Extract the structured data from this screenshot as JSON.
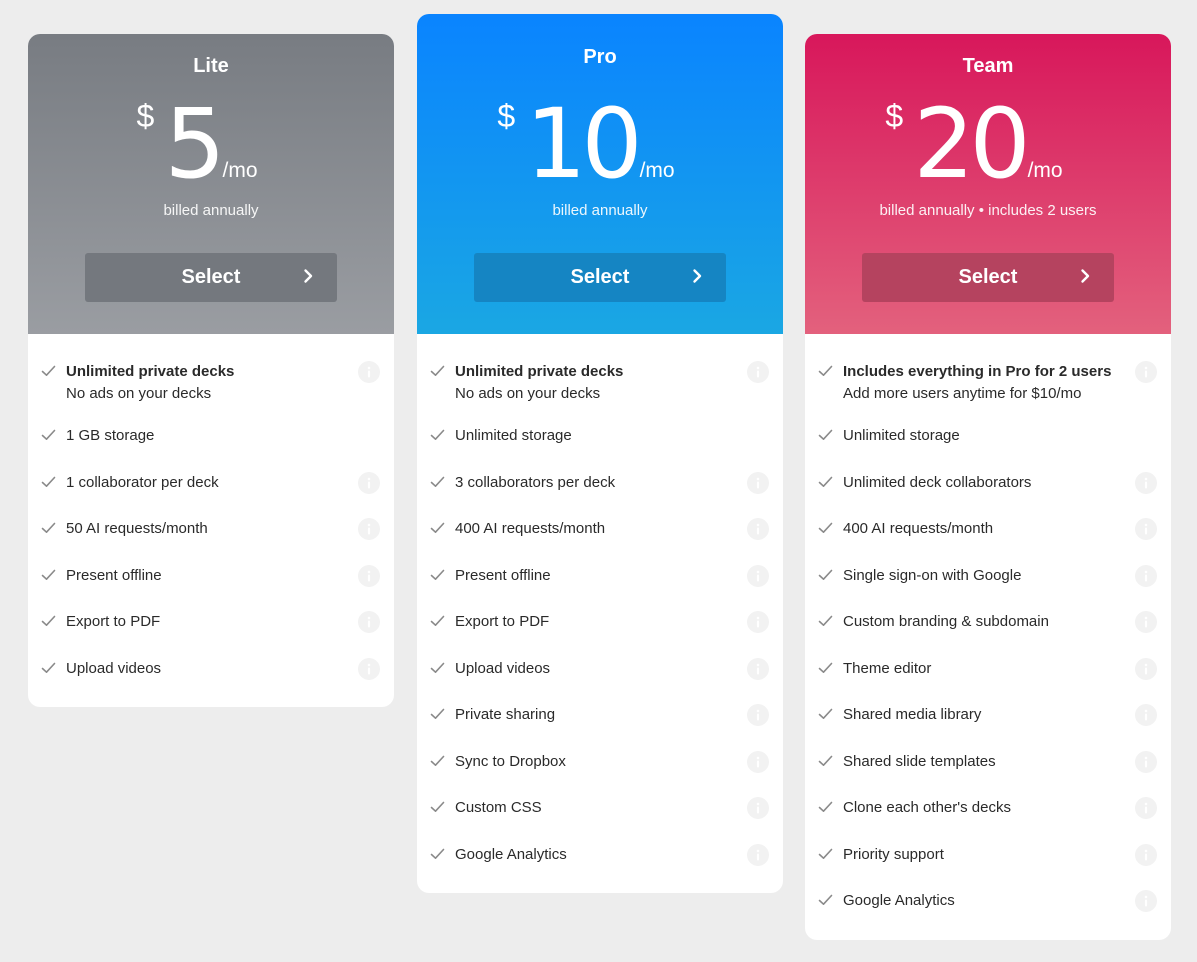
{
  "plans": [
    {
      "name": "Lite",
      "currency": "$",
      "amount": "5",
      "per": "/mo",
      "billing": "billed annually",
      "select_label": "Select",
      "features": [
        {
          "title": "Unlimited private decks",
          "sub": "No ads on your decks",
          "bold": true,
          "info": true
        },
        {
          "title": "1 GB storage",
          "info": false
        },
        {
          "title": "1 collaborator per deck",
          "info": true
        },
        {
          "title": "50 AI requests/month",
          "info": true
        },
        {
          "title": "Present offline",
          "info": true
        },
        {
          "title": "Export to PDF",
          "info": true
        },
        {
          "title": "Upload videos",
          "info": true
        }
      ]
    },
    {
      "name": "Pro",
      "currency": "$",
      "amount": "10",
      "per": "/mo",
      "billing": "billed annually",
      "select_label": "Select",
      "features": [
        {
          "title": "Unlimited private decks",
          "sub": "No ads on your decks",
          "bold": true,
          "info": true
        },
        {
          "title": "Unlimited storage",
          "info": false
        },
        {
          "title": "3 collaborators per deck",
          "info": true
        },
        {
          "title": "400 AI requests/month",
          "info": true
        },
        {
          "title": "Present offline",
          "info": true
        },
        {
          "title": "Export to PDF",
          "info": true
        },
        {
          "title": "Upload videos",
          "info": true
        },
        {
          "title": "Private sharing",
          "info": true
        },
        {
          "title": "Sync to Dropbox",
          "info": true
        },
        {
          "title": "Custom CSS",
          "info": true
        },
        {
          "title": "Google Analytics",
          "info": true
        }
      ]
    },
    {
      "name": "Team",
      "currency": "$",
      "amount": "20",
      "per": "/mo",
      "billing": "billed annually • includes 2 users",
      "select_label": "Select",
      "features": [
        {
          "title": "Includes everything in Pro for 2 users",
          "sub": "Add more users anytime for $10/mo",
          "bold": true,
          "info": true
        },
        {
          "title": "Unlimited storage",
          "info": false
        },
        {
          "title": "Unlimited deck collaborators",
          "info": true
        },
        {
          "title": "400 AI requests/month",
          "info": true
        },
        {
          "title": "Single sign-on with Google",
          "info": true
        },
        {
          "title": "Custom branding & subdomain",
          "info": true
        },
        {
          "title": "Theme editor",
          "info": true
        },
        {
          "title": "Shared media library",
          "info": true
        },
        {
          "title": "Shared slide templates",
          "info": true
        },
        {
          "title": "Clone each other's decks",
          "info": true
        },
        {
          "title": "Priority support",
          "info": true
        },
        {
          "title": "Google Analytics",
          "info": true
        }
      ]
    }
  ],
  "colors": {
    "lite_header": "#787c82",
    "pro_header": "#0a84ff",
    "team_header": "#d8175b",
    "background": "#ededed"
  },
  "icons": {
    "check": "check-icon",
    "info": "info-icon",
    "chevron": "chevron-right-icon"
  }
}
